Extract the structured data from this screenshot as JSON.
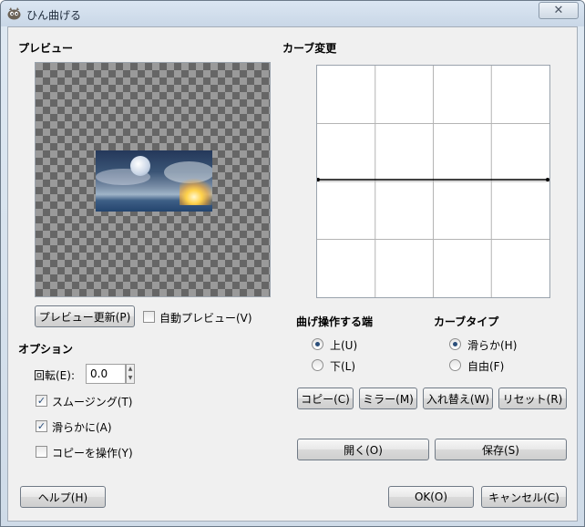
{
  "window": {
    "title": "ひん曲げる",
    "close_icon": "close-icon"
  },
  "preview": {
    "section_title": "プレビュー",
    "update_button": "プレビュー更新(P)",
    "auto_preview_label": "自動プレビュー(V)",
    "auto_preview_checked": false
  },
  "curve": {
    "section_title": "カーブ変更",
    "grid_divisions": 4,
    "line_level_fraction": 0.5
  },
  "edge": {
    "section_title": "曲げ操作する端",
    "options": [
      {
        "label": "上(U)",
        "checked": true
      },
      {
        "label": "下(L)",
        "checked": false
      }
    ]
  },
  "curve_type": {
    "section_title": "カーブタイプ",
    "options": [
      {
        "label": "滑らか(H)",
        "checked": true
      },
      {
        "label": "自由(F)",
        "checked": false
      }
    ]
  },
  "options": {
    "section_title": "オプション",
    "rotate_label": "回転(E):",
    "rotate_value": "0.0",
    "smoothing_label": "スムージング(T)",
    "smoothing_checked": true,
    "antialias_label": "滑らかに(A)",
    "antialias_checked": true,
    "work_on_copy_label": "コピーを操作(Y)",
    "work_on_copy_checked": false
  },
  "curve_buttons": {
    "copy": "コピー(C)",
    "mirror": "ミラー(M)",
    "swap": "入れ替え(W)",
    "reset": "リセット(R)"
  },
  "file_buttons": {
    "open": "開く(O)",
    "save": "保存(S)"
  },
  "dialog_buttons": {
    "help": "ヘルプ(H)",
    "ok": "OK(O)",
    "cancel": "キャンセル(C)"
  },
  "check_mark": "✓"
}
